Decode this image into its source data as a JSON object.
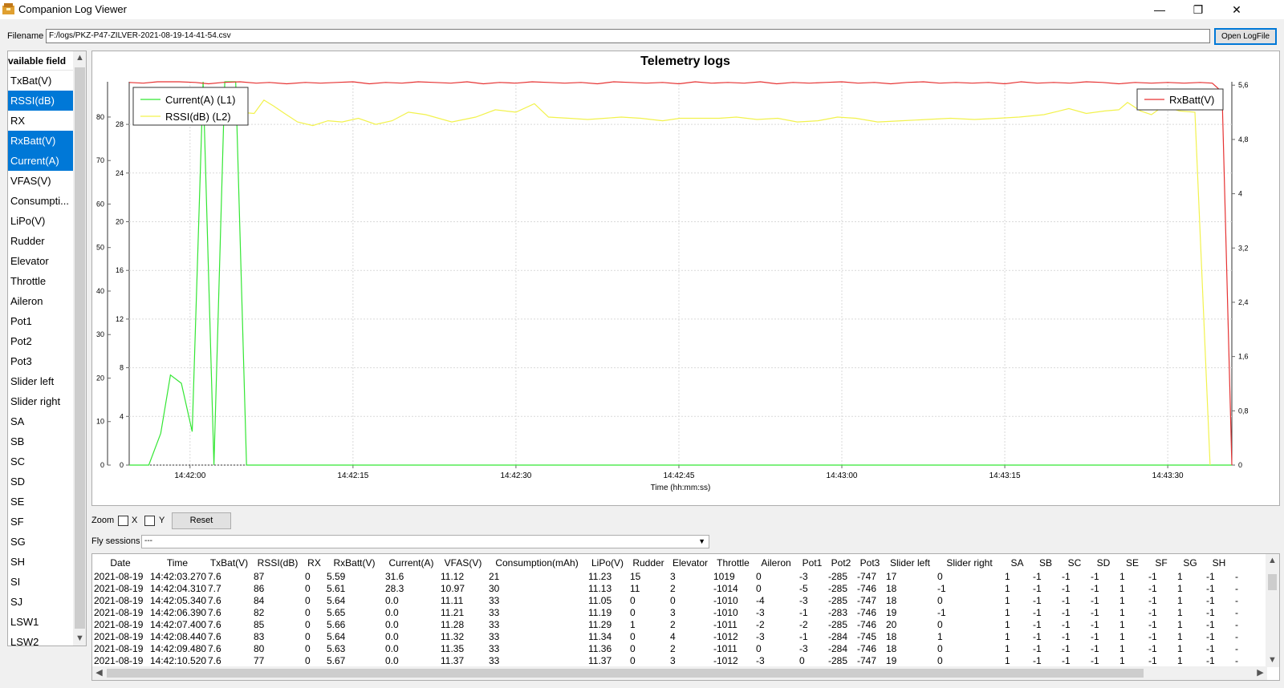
{
  "window": {
    "title": "Companion Log Viewer",
    "minimize": "—",
    "maximize": "❐",
    "close": "✕"
  },
  "file": {
    "label": "Filename",
    "value": "F:/logs/PKZ-P47-ZILVER-2021-08-19-14-41-54.csv",
    "open_button": "Open LogFile"
  },
  "fields": {
    "header": "vailable field",
    "items": [
      {
        "label": "TxBat(V)",
        "selected": false
      },
      {
        "label": "RSSI(dB)",
        "selected": true
      },
      {
        "label": "RX",
        "selected": false
      },
      {
        "label": "RxBatt(V)",
        "selected": true
      },
      {
        "label": "Current(A)",
        "selected": true
      },
      {
        "label": "VFAS(V)",
        "selected": false
      },
      {
        "label": "Consumpti...",
        "selected": false
      },
      {
        "label": "LiPo(V)",
        "selected": false
      },
      {
        "label": "Rudder",
        "selected": false
      },
      {
        "label": "Elevator",
        "selected": false
      },
      {
        "label": "Throttle",
        "selected": false
      },
      {
        "label": "Aileron",
        "selected": false
      },
      {
        "label": "Pot1",
        "selected": false
      },
      {
        "label": "Pot2",
        "selected": false
      },
      {
        "label": "Pot3",
        "selected": false
      },
      {
        "label": "Slider left",
        "selected": false
      },
      {
        "label": "Slider right",
        "selected": false
      },
      {
        "label": "SA",
        "selected": false
      },
      {
        "label": "SB",
        "selected": false
      },
      {
        "label": "SC",
        "selected": false
      },
      {
        "label": "SD",
        "selected": false
      },
      {
        "label": "SE",
        "selected": false
      },
      {
        "label": "SF",
        "selected": false
      },
      {
        "label": "SG",
        "selected": false
      },
      {
        "label": "SH",
        "selected": false
      },
      {
        "label": "SI",
        "selected": false
      },
      {
        "label": "SJ",
        "selected": false
      },
      {
        "label": "LSW1",
        "selected": false
      },
      {
        "label": "LSW2",
        "selected": false
      }
    ]
  },
  "chart_data": {
    "type": "line",
    "title": "Telemetry logs",
    "xlabel": "Time (hh:mm:ss)",
    "x_ticks": [
      "14:42:00",
      "14:42:15",
      "14:42:30",
      "14:42:45",
      "14:43:00",
      "14:43:15",
      "14:43:30"
    ],
    "x_tick_seconds": [
      0,
      15,
      30,
      45,
      60,
      75,
      90
    ],
    "xlim": [
      -5.6,
      95.9
    ],
    "grid": true,
    "axes": {
      "L1": {
        "side": "left-outer",
        "ticks": [
          "0",
          "10",
          "20",
          "30",
          "40",
          "50",
          "60",
          "70",
          "80"
        ],
        "ylim": [
          0,
          88.1
        ]
      },
      "L2": {
        "side": "left-inner",
        "ticks": [
          "0",
          "4",
          "8",
          "12",
          "16",
          "20",
          "24",
          "28"
        ],
        "ylim": [
          0,
          31.5
        ]
      },
      "R1": {
        "side": "right",
        "ticks": [
          "0",
          "0,8",
          "1,6",
          "2,4",
          "3,2",
          "4",
          "4,8",
          "5,6"
        ],
        "ylim": [
          0,
          5.65
        ]
      }
    },
    "legend_left": [
      {
        "label": "Current(A) (L1)",
        "color": "#33e633"
      },
      {
        "label": "RSSI(dB) (L2)",
        "color": "#f2f24d"
      }
    ],
    "legend_right": [
      {
        "label": "RxBatt(V)",
        "color": "#e63232"
      }
    ],
    "series": [
      {
        "name": "Current(A) (L1)",
        "axis": "L1",
        "color": "#33e633",
        "x": [
          -5.6,
          -3.8,
          -2.7,
          -1.8,
          -0.8,
          0.2,
          1.2,
          2.2,
          3.2,
          4.2,
          5.2,
          94.2,
          95.9
        ],
        "y": [
          0,
          0,
          7.3,
          20.7,
          18.8,
          7.7,
          88.1,
          0,
          88.1,
          88.1,
          0,
          0,
          0
        ]
      },
      {
        "name": "RSSI(dB)",
        "axis": "L2",
        "color": "#f2f24d",
        "x": [
          -4.6,
          -3.3,
          -2.2,
          -1.3,
          0.0,
          1.3,
          2.3,
          3.3,
          4.5,
          5.9,
          6.8,
          7.7,
          8.7,
          9.9,
          11.3,
          12.7,
          14.0,
          15.5,
          17.1,
          18.6,
          20.1,
          21.7,
          24.1,
          26.3,
          28.1,
          30.0,
          31.7,
          33.0,
          34.9,
          36.6,
          38.2,
          39.7,
          41.5,
          43.5,
          45.1,
          47.0,
          48.7,
          50.3,
          52.2,
          54.1,
          55.9,
          57.8,
          59.6,
          61.3,
          63.3,
          65.5,
          67.8,
          70.0,
          72.2,
          74.4,
          76.3,
          78.6,
          80.0,
          80.9,
          82.5,
          84.2,
          85.5,
          86.3,
          87.5,
          88.5,
          89.6,
          91.1,
          92.5,
          93.9
        ],
        "y": [
          29.0,
          28.6,
          29.5,
          29.0,
          28.6,
          29.3,
          29.3,
          29.3,
          29.0,
          28.9,
          30.0,
          29.5,
          28.9,
          28.2,
          27.9,
          28.3,
          28.2,
          28.5,
          28.0,
          28.3,
          29.0,
          28.8,
          28.2,
          28.6,
          29.2,
          29.0,
          29.7,
          28.6,
          28.5,
          28.4,
          28.5,
          28.6,
          28.5,
          28.3,
          28.5,
          28.5,
          28.5,
          28.6,
          28.4,
          28.5,
          28.2,
          28.3,
          28.6,
          28.5,
          28.2,
          28.3,
          28.4,
          28.5,
          28.4,
          28.5,
          28.6,
          28.8,
          29.1,
          29.3,
          28.9,
          29.1,
          29.2,
          29.8,
          29.1,
          28.8,
          29.5,
          29.1,
          29.0,
          0
        ]
      },
      {
        "name": "RxBatt(V)",
        "axis": "R1",
        "color": "#e63232",
        "x": [
          -5.6,
          -4.3,
          -3.0,
          -1.0,
          0.5,
          1.7,
          3.0,
          4.6,
          6.1,
          7.3,
          8.9,
          10.6,
          12.0,
          13.5,
          15.0,
          16.5,
          18.0,
          19.5,
          21.0,
          22.5,
          24.0,
          25.5,
          27.0,
          28.5,
          30.0,
          31.5,
          33.0,
          34.5,
          36.0,
          37.5,
          39.0,
          40.5,
          42.0,
          43.5,
          45.0,
          46.5,
          48.0,
          49.5,
          51.0,
          52.5,
          54.0,
          55.5,
          57.0,
          58.5,
          60.0,
          61.5,
          63.0,
          64.5,
          66.0,
          67.5,
          69.0,
          70.5,
          72.0,
          73.5,
          75.0,
          76.5,
          78.0,
          79.5,
          81.0,
          82.5,
          84.0,
          85.5,
          87.0,
          88.5,
          90.0,
          91.5,
          93.0,
          94.1,
          95.0,
          95.9
        ],
        "y": [
          5.64,
          5.63,
          5.65,
          5.65,
          5.64,
          5.62,
          5.64,
          5.65,
          5.63,
          5.64,
          5.62,
          5.64,
          5.63,
          5.64,
          5.65,
          5.62,
          5.64,
          5.63,
          5.65,
          5.64,
          5.63,
          5.65,
          5.62,
          5.64,
          5.63,
          5.65,
          5.64,
          5.63,
          5.64,
          5.62,
          5.65,
          5.64,
          5.63,
          5.64,
          5.62,
          5.65,
          5.63,
          5.64,
          5.63,
          5.65,
          5.62,
          5.64,
          5.63,
          5.64,
          5.65,
          5.63,
          5.64,
          5.62,
          5.64,
          5.65,
          5.63,
          5.64,
          5.63,
          5.64,
          5.62,
          5.65,
          5.63,
          5.64,
          5.63,
          5.65,
          5.64,
          5.62,
          5.64,
          5.63,
          5.64,
          5.63,
          5.64,
          5.63,
          5.5,
          0
        ]
      }
    ]
  },
  "controls": {
    "zoom_label": "Zoom",
    "x_label": "X",
    "y_label": "Y",
    "reset": "Reset",
    "fly_label": "Fly sessions",
    "fly_value": "---"
  },
  "table": {
    "columns": [
      "Date",
      "Time",
      "TxBat(V)",
      "RSSI(dB)",
      "RX",
      "RxBatt(V)",
      "Current(A)",
      "VFAS(V)",
      "Consumption(mAh)",
      "LiPo(V)",
      "Rudder",
      "Elevator",
      "Throttle",
      "Aileron",
      "Pot1",
      "Pot2",
      "Pot3",
      "Slider left",
      "Slider right",
      "SA",
      "SB",
      "SC",
      "SD",
      "SE",
      "SF",
      "SG",
      "SH",
      ""
    ],
    "rows": [
      [
        "2021-08-19",
        "14:42:03.270",
        "7.6",
        "87",
        "0",
        "5.59",
        "31.6",
        "11.12",
        "21",
        "11.23",
        "15",
        "3",
        "1019",
        "0",
        "-3",
        "-285",
        "-747",
        "17",
        "0",
        "1",
        "-1",
        "-1",
        "-1",
        "1",
        "-1",
        "1",
        "-1",
        "-"
      ],
      [
        "2021-08-19",
        "14:42:04.310",
        "7.7",
        "86",
        "0",
        "5.61",
        "28.3",
        "10.97",
        "30",
        "11.13",
        "11",
        "2",
        "-1014",
        "0",
        "-5",
        "-285",
        "-746",
        "18",
        "-1",
        "1",
        "-1",
        "-1",
        "-1",
        "1",
        "-1",
        "1",
        "-1",
        "-"
      ],
      [
        "2021-08-19",
        "14:42:05.340",
        "7.6",
        "84",
        "0",
        "5.64",
        "0.0",
        "11.11",
        "33",
        "11.05",
        "0",
        "0",
        "-1010",
        "-4",
        "-3",
        "-285",
        "-747",
        "18",
        "0",
        "1",
        "-1",
        "-1",
        "-1",
        "1",
        "-1",
        "1",
        "-1",
        "-"
      ],
      [
        "2021-08-19",
        "14:42:06.390",
        "7.6",
        "82",
        "0",
        "5.65",
        "0.0",
        "11.21",
        "33",
        "11.19",
        "0",
        "3",
        "-1010",
        "-3",
        "-1",
        "-283",
        "-746",
        "19",
        "-1",
        "1",
        "-1",
        "-1",
        "-1",
        "1",
        "-1",
        "1",
        "-1",
        "-"
      ],
      [
        "2021-08-19",
        "14:42:07.400",
        "7.6",
        "85",
        "0",
        "5.66",
        "0.0",
        "11.28",
        "33",
        "11.29",
        "1",
        "2",
        "-1011",
        "-2",
        "-2",
        "-285",
        "-746",
        "20",
        "0",
        "1",
        "-1",
        "-1",
        "-1",
        "1",
        "-1",
        "1",
        "-1",
        "-"
      ],
      [
        "2021-08-19",
        "14:42:08.440",
        "7.6",
        "83",
        "0",
        "5.64",
        "0.0",
        "11.32",
        "33",
        "11.34",
        "0",
        "4",
        "-1012",
        "-3",
        "-1",
        "-284",
        "-745",
        "18",
        "1",
        "1",
        "-1",
        "-1",
        "-1",
        "1",
        "-1",
        "1",
        "-1",
        "-"
      ],
      [
        "2021-08-19",
        "14:42:09.480",
        "7.6",
        "80",
        "0",
        "5.63",
        "0.0",
        "11.35",
        "33",
        "11.36",
        "0",
        "2",
        "-1011",
        "0",
        "-3",
        "-284",
        "-746",
        "18",
        "0",
        "1",
        "-1",
        "-1",
        "-1",
        "1",
        "-1",
        "1",
        "-1",
        "-"
      ],
      [
        "2021-08-19",
        "14:42:10.520",
        "7.6",
        "77",
        "0",
        "5.67",
        "0.0",
        "11.37",
        "33",
        "11.37",
        "0",
        "3",
        "-1012",
        "-3",
        "0",
        "-285",
        "-747",
        "19",
        "0",
        "1",
        "-1",
        "-1",
        "-1",
        "1",
        "-1",
        "1",
        "-1",
        "-"
      ]
    ]
  }
}
